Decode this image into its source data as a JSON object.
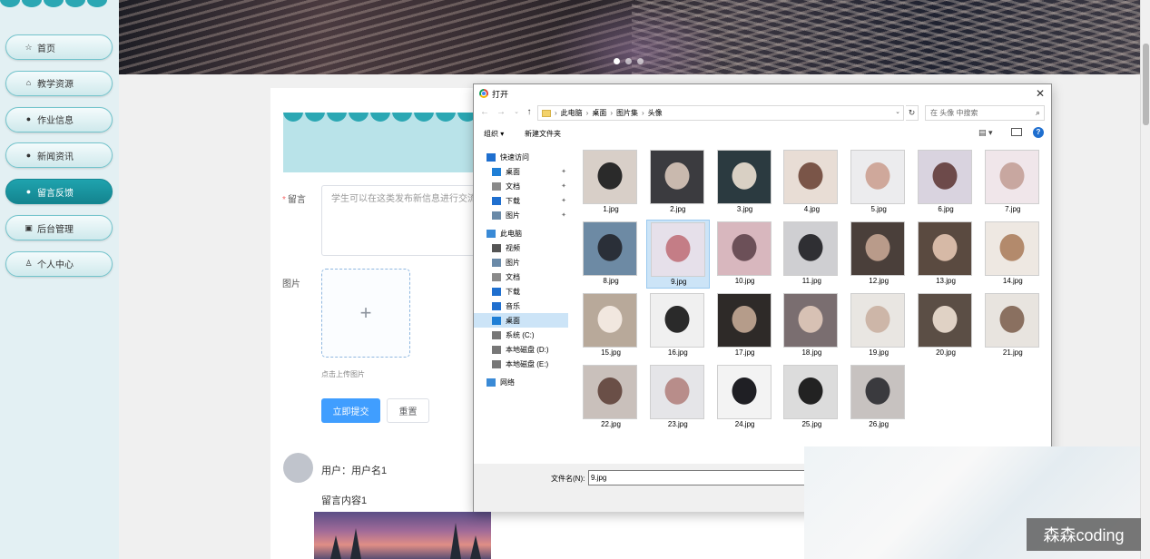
{
  "sidebar": {
    "items": [
      {
        "label": "首页",
        "icon": "star-icon"
      },
      {
        "label": "教学资源",
        "icon": "home-icon"
      },
      {
        "label": "作业信息",
        "icon": "info-icon"
      },
      {
        "label": "新闻资讯",
        "icon": "help-icon"
      },
      {
        "label": "留言反馈",
        "icon": "info-icon",
        "active": true
      },
      {
        "label": "后台管理",
        "icon": "calendar-icon"
      },
      {
        "label": "个人中心",
        "icon": "user-icon"
      }
    ]
  },
  "banner": {
    "slides": 3,
    "active_slide": 1
  },
  "form": {
    "message_label": "留言",
    "message_placeholder": "学生可以在这类发布新信息进行交流分",
    "image_label": "图片",
    "upload_hint": "点击上传图片",
    "submit_label": "立即提交",
    "reset_label": "重置"
  },
  "comment": {
    "user_label": "用户：用户名1",
    "content": "留言内容1"
  },
  "dialog": {
    "title": "打开",
    "path": [
      "此电脑",
      "桌面",
      "图片集",
      "头像"
    ],
    "search_placeholder": "在 头像 中搜索",
    "organize_label": "组织",
    "new_folder_label": "新建文件夹",
    "tree": [
      {
        "label": "快速访问",
        "icon": "star-icon",
        "pinned": false,
        "indent": 0
      },
      {
        "label": "桌面",
        "icon": "desktop-icon",
        "pinned": true,
        "indent": 1
      },
      {
        "label": "文档",
        "icon": "document-icon",
        "pinned": true,
        "indent": 1
      },
      {
        "label": "下载",
        "icon": "download-icon",
        "pinned": true,
        "indent": 1
      },
      {
        "label": "图片",
        "icon": "picture-icon",
        "pinned": true,
        "indent": 1
      },
      {
        "label": "此电脑",
        "icon": "computer-icon",
        "pinned": false,
        "indent": 0
      },
      {
        "label": "视频",
        "icon": "video-icon",
        "pinned": false,
        "indent": 1
      },
      {
        "label": "图片",
        "icon": "picture-icon",
        "pinned": false,
        "indent": 1
      },
      {
        "label": "文档",
        "icon": "document-icon",
        "pinned": false,
        "indent": 1
      },
      {
        "label": "下载",
        "icon": "download-icon",
        "pinned": false,
        "indent": 1
      },
      {
        "label": "音乐",
        "icon": "music-icon",
        "pinned": false,
        "indent": 1
      },
      {
        "label": "桌面",
        "icon": "desktop-icon",
        "pinned": false,
        "indent": 1,
        "selected": true
      },
      {
        "label": "系统 (C:)",
        "icon": "drive-icon",
        "pinned": false,
        "indent": 1
      },
      {
        "label": "本地磁盘 (D:)",
        "icon": "drive-icon",
        "pinned": false,
        "indent": 1
      },
      {
        "label": "本地磁盘 (E:)",
        "icon": "drive-icon",
        "pinned": false,
        "indent": 1
      },
      {
        "label": "网络",
        "icon": "network-icon",
        "pinned": false,
        "indent": 0
      }
    ],
    "files": [
      "1.jpg",
      "2.jpg",
      "3.jpg",
      "4.jpg",
      "5.jpg",
      "6.jpg",
      "7.jpg",
      "8.jpg",
      "9.jpg",
      "10.jpg",
      "11.jpg",
      "12.jpg",
      "13.jpg",
      "14.jpg",
      "15.jpg",
      "16.jpg",
      "17.jpg",
      "18.jpg",
      "19.jpg",
      "20.jpg",
      "21.jpg",
      "22.jpg",
      "23.jpg",
      "24.jpg",
      "25.jpg",
      "26.jpg"
    ],
    "selected_file": "9.jpg",
    "filename_label": "文件名(N):",
    "filename_value": "9.jpg"
  },
  "watermark": "森森coding"
}
